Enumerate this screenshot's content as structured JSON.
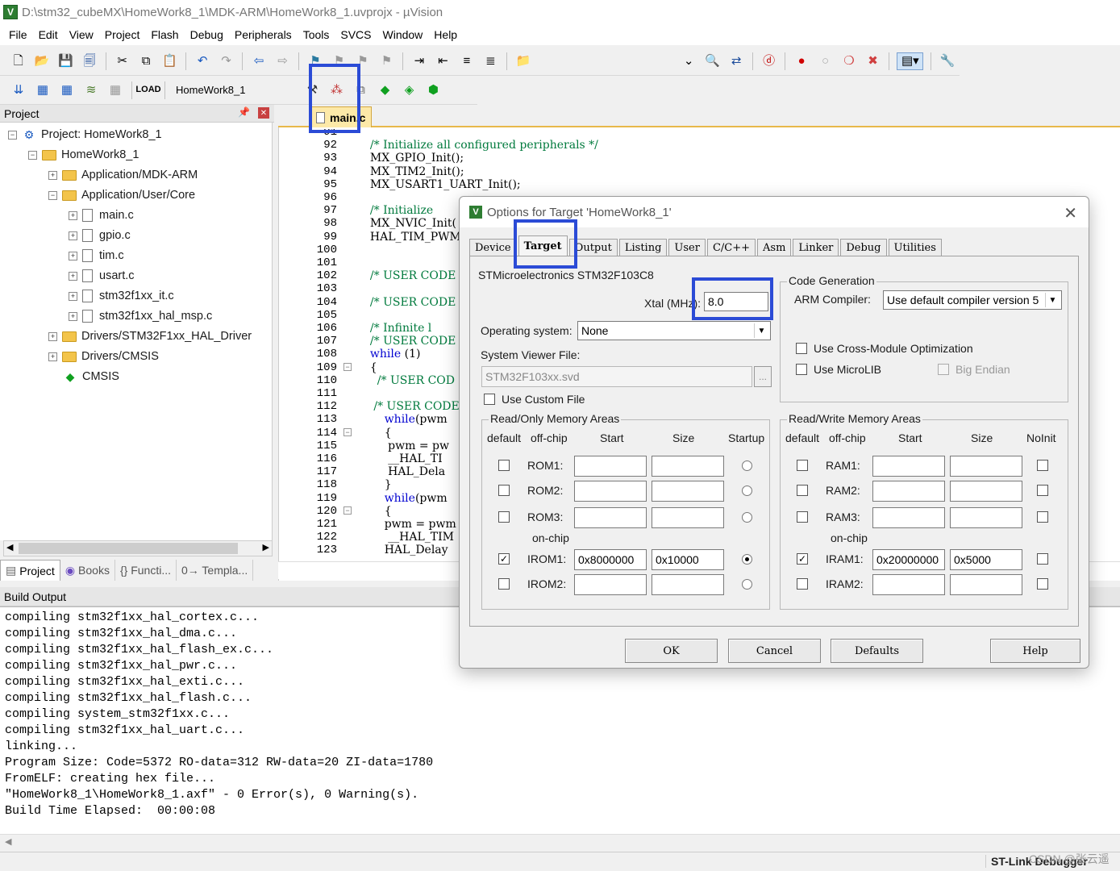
{
  "window": {
    "title": "D:\\stm32_cubeMX\\HomeWork8_1\\MDK-ARM\\HomeWork8_1.uvprojx - µVision"
  },
  "menu": [
    "File",
    "Edit",
    "View",
    "Project",
    "Flash",
    "Debug",
    "Peripherals",
    "Tools",
    "SVCS",
    "Window",
    "Help"
  ],
  "toolbar2": {
    "target_name": "HomeWork8_1"
  },
  "project_panel": {
    "header": "Project",
    "tree": [
      {
        "label": "Project: HomeWork8_1"
      },
      {
        "label": "HomeWork8_1"
      },
      {
        "label": "Application/MDK-ARM"
      },
      {
        "label": "Application/User/Core"
      },
      {
        "label": "main.c"
      },
      {
        "label": "gpio.c"
      },
      {
        "label": "tim.c"
      },
      {
        "label": "usart.c"
      },
      {
        "label": "stm32f1xx_it.c"
      },
      {
        "label": "stm32f1xx_hal_msp.c"
      },
      {
        "label": "Drivers/STM32F1xx_HAL_Driver"
      },
      {
        "label": "Drivers/CMSIS"
      },
      {
        "label": "CMSIS"
      }
    ],
    "tabs": [
      "Project",
      "Books",
      "{} Functi...",
      "0→ Templa..."
    ]
  },
  "editor": {
    "tab": "main.c",
    "line_numbers": [
      "91",
      "92",
      "93",
      "94",
      "95",
      "96",
      "97",
      "98",
      "99",
      "100",
      "101",
      "102",
      "103",
      "104",
      "105",
      "106",
      "107",
      "108",
      "109",
      "110",
      "111",
      "112",
      "113",
      "114",
      "115",
      "116",
      "117",
      "118",
      "119",
      "120",
      "121",
      "122",
      "123"
    ],
    "code": [
      "",
      "  /* Initialize all configured peripherals */",
      "  MX_GPIO_Init();",
      "  MX_TIM2_Init();",
      "  MX_USART1_UART_Init();",
      "",
      "  /* Initialize",
      "  MX_NVIC_Init(",
      "  HAL_TIM_PWM_S",
      "",
      "",
      "  /* USER CODE",
      "",
      "  /* USER CODE",
      "",
      "  /* Infinite l",
      "  /* USER CODE",
      "  while (1)",
      "  {",
      "    /* USER COD",
      "",
      "   /* USER CODE",
      "      while(pwm",
      "      {",
      "       pwm = pw",
      "       __HAL_TI",
      "       HAL_Dela",
      "      }",
      "      while(pwm",
      "      {",
      "      pwm = pwm",
      "       __HAL_TIM",
      "      HAL_Delay"
    ]
  },
  "build_output": {
    "header": "Build Output",
    "lines": [
      "compiling stm32f1xx_hal_cortex.c...",
      "compiling stm32f1xx_hal_dma.c...",
      "compiling stm32f1xx_hal_flash_ex.c...",
      "compiling stm32f1xx_hal_pwr.c...",
      "compiling stm32f1xx_hal_exti.c...",
      "compiling stm32f1xx_hal_flash.c...",
      "compiling system_stm32f1xx.c...",
      "compiling stm32f1xx_hal_uart.c...",
      "linking...",
      "Program Size: Code=5372 RO-data=312 RW-data=20 ZI-data=1780",
      "FromELF: creating hex file...",
      "\"HomeWork8_1\\HomeWork8_1.axf\" - 0 Error(s), 0 Warning(s).",
      "Build Time Elapsed:  00:00:08"
    ]
  },
  "status": {
    "debugger": "ST-Link Debugger",
    "watermark": "CSDN @张云遥"
  },
  "dialog": {
    "title": "Options for Target 'HomeWork8_1'",
    "tabs": [
      "Device",
      "Target",
      "Output",
      "Listing",
      "User",
      "C/C++",
      "Asm",
      "Linker",
      "Debug",
      "Utilities"
    ],
    "active_tab": "Target",
    "device": "STMicroelectronics STM32F103C8",
    "xtal_label": "Xtal (MHz):",
    "xtal_value": "8.0",
    "os_label": "Operating system:",
    "os_value": "None",
    "svf_label": "System Viewer File:",
    "svf_value": "STM32F103xx.svd",
    "custom_file_label": "Use Custom File",
    "codegen": {
      "title": "Code Generation",
      "compiler_label": "ARM Compiler:",
      "compiler_value": "Use default compiler version 5",
      "cross_module": "Use Cross-Module Optimization",
      "microlib": "Use MicroLIB",
      "big_endian": "Big Endian"
    },
    "ro": {
      "title": "Read/Only Memory Areas",
      "headers": [
        "default",
        "off-chip",
        "Start",
        "Size",
        "Startup"
      ],
      "onchip": "on-chip",
      "rows": [
        {
          "name": "ROM1:",
          "start": "",
          "size": "",
          "default": false,
          "startup": false
        },
        {
          "name": "ROM2:",
          "start": "",
          "size": "",
          "default": false,
          "startup": false
        },
        {
          "name": "ROM3:",
          "start": "",
          "size": "",
          "default": false,
          "startup": false
        },
        {
          "name": "IROM1:",
          "start": "0x8000000",
          "size": "0x10000",
          "default": true,
          "startup": true
        },
        {
          "name": "IROM2:",
          "start": "",
          "size": "",
          "default": false,
          "startup": false
        }
      ]
    },
    "rw": {
      "title": "Read/Write Memory Areas",
      "headers": [
        "default",
        "off-chip",
        "Start",
        "Size",
        "NoInit"
      ],
      "onchip": "on-chip",
      "rows": [
        {
          "name": "RAM1:",
          "start": "",
          "size": "",
          "default": false,
          "noinit": false
        },
        {
          "name": "RAM2:",
          "start": "",
          "size": "",
          "default": false,
          "noinit": false
        },
        {
          "name": "RAM3:",
          "start": "",
          "size": "",
          "default": false,
          "noinit": false
        },
        {
          "name": "IRAM1:",
          "start": "0x20000000",
          "size": "0x5000",
          "default": true,
          "noinit": false
        },
        {
          "name": "IRAM2:",
          "start": "",
          "size": "",
          "default": false,
          "noinit": false
        }
      ]
    },
    "buttons": {
      "ok": "OK",
      "cancel": "Cancel",
      "defaults": "Defaults",
      "help": "Help"
    }
  },
  "colors": {
    "highlight": "#2b4bd6",
    "comment": "#007a3d",
    "keyword": "#0000d0"
  }
}
